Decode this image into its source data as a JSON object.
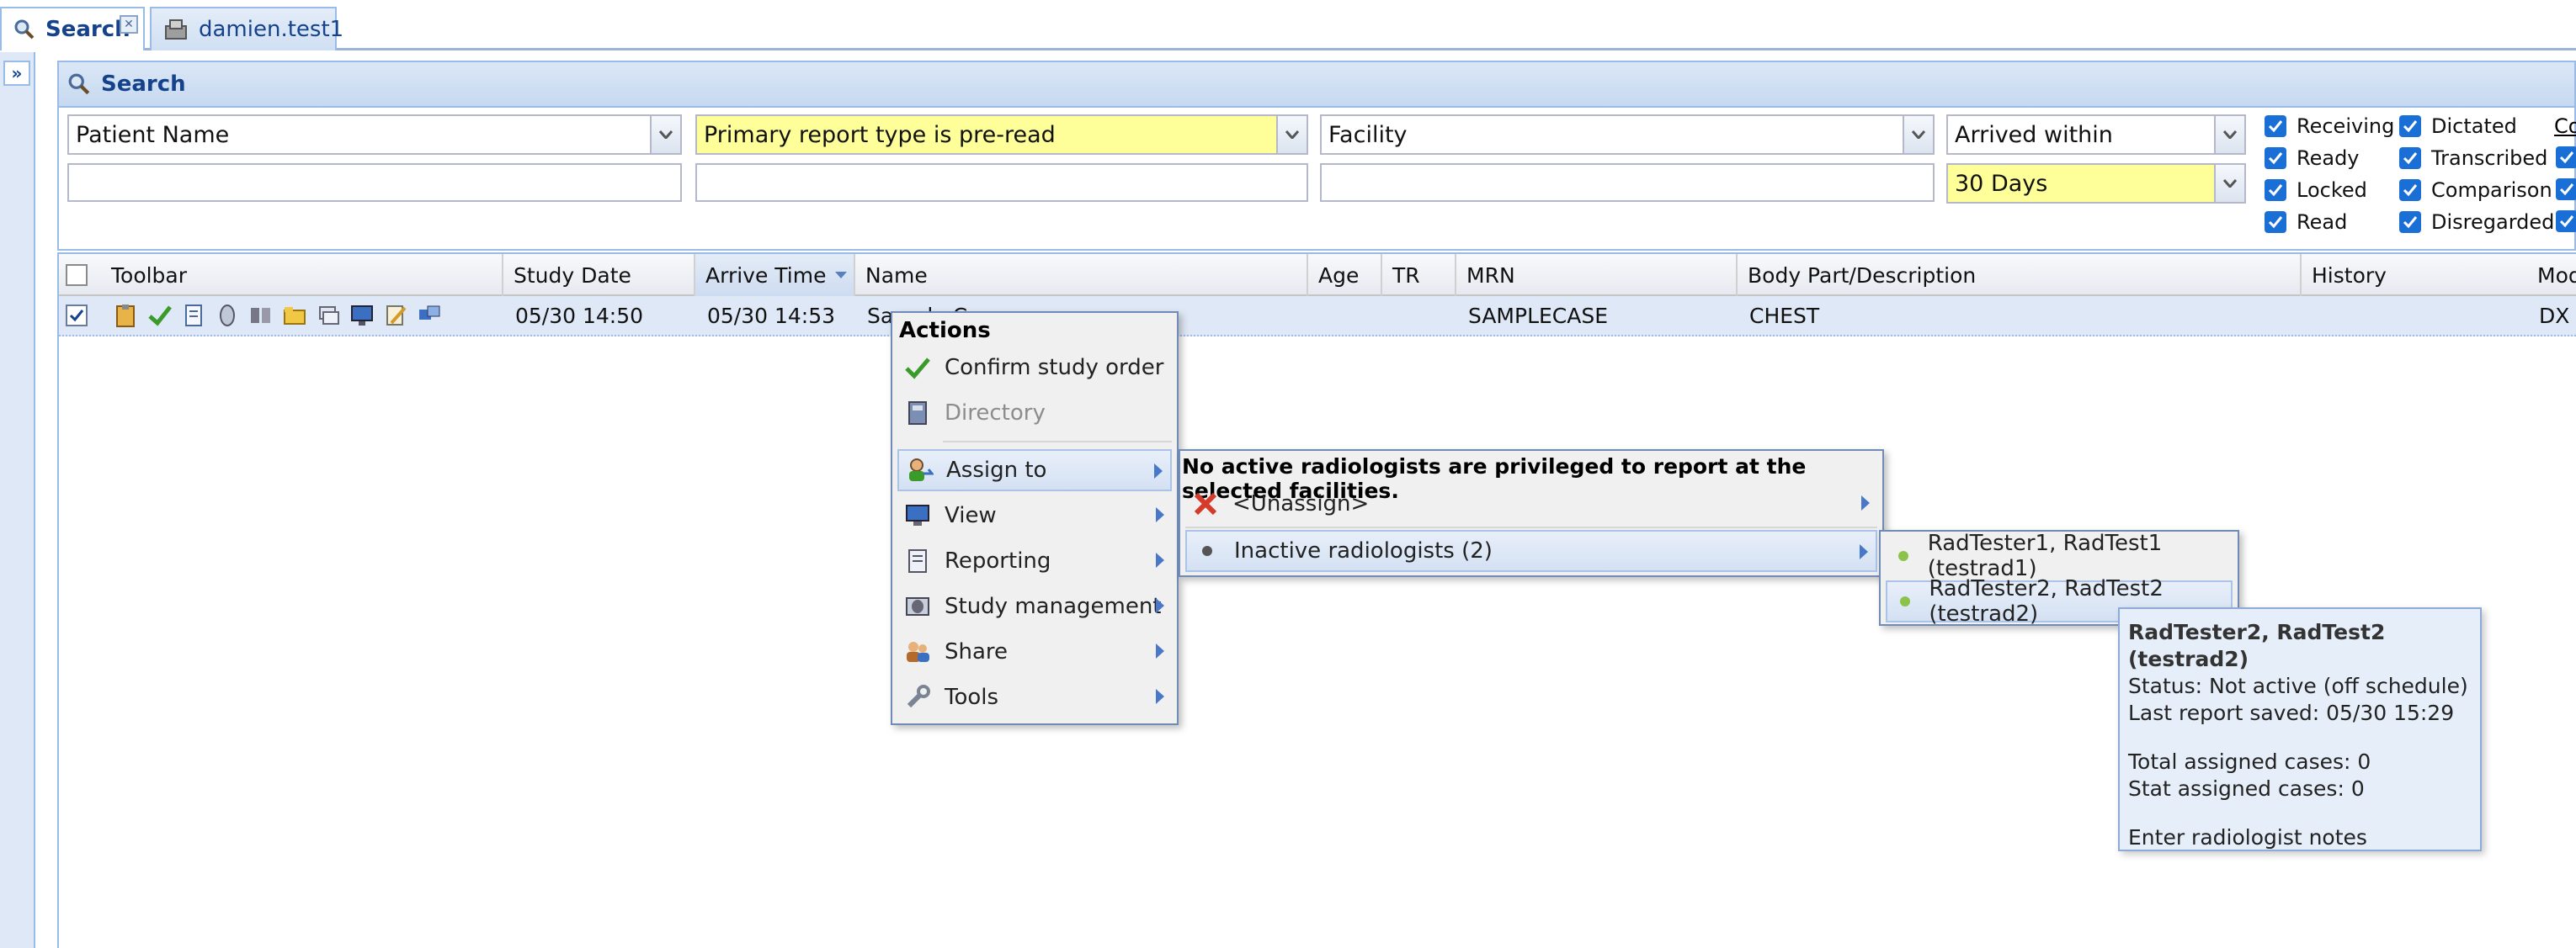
{
  "tabs": [
    {
      "label": "Search"
    },
    {
      "label": "damien.test1"
    }
  ],
  "panel": {
    "title": "Search"
  },
  "filters": {
    "patient_name": "Patient Name",
    "report_type": "Primary report type is pre-read",
    "facility": "Facility",
    "arrived": "Arrived within",
    "days": "30 Days",
    "statuses": [
      "Receiving",
      "Ready",
      "Locked",
      "Read",
      "Dictated",
      "Transcribed",
      "Comparison",
      "Disregarded"
    ],
    "columns_link": "Co"
  },
  "colors": {
    "highlight": "#ffff99",
    "accent": "#15428b",
    "checkbox": "#1a6fd6",
    "menu_bg": "#f0f0f0",
    "tooltip_bg": "#e6eef9"
  },
  "grid": {
    "headers": [
      "Toolbar",
      "Study Date",
      "Arrive Time",
      "Name",
      "Age",
      "TR",
      "MRN",
      "Body Part/Description",
      "History",
      "Mod"
    ],
    "row": {
      "study_date": "05/30 14:50",
      "arrive_time": "05/30 14:53",
      "name": "Sample C",
      "mrn": "SAMPLECASE",
      "body_part": "CHEST",
      "mod": "DX"
    }
  },
  "actions_menu": {
    "title": "Actions",
    "items": [
      "Confirm study order",
      "Directory",
      "Assign to",
      "View",
      "Reporting",
      "Study management",
      "Share",
      "Tools"
    ]
  },
  "assign_menu": {
    "notice": "No active radiologists are privileged to report at the selected facilities.",
    "unassign": "<Unassign>",
    "inactive": "Inactive radiologists (2)"
  },
  "radiologists": [
    "RadTester1, RadTest1 (testrad1)",
    "RadTester2, RadTest2 (testrad2)"
  ],
  "tooltip": {
    "title": "RadTester2, RadTest2 (testrad2)",
    "status": "Status: Not active (off schedule)",
    "last_report": "Last report saved: 05/30 15:29",
    "total": "Total assigned cases: 0",
    "stat": "Stat assigned cases: 0",
    "notes": "Enter radiologist notes"
  }
}
